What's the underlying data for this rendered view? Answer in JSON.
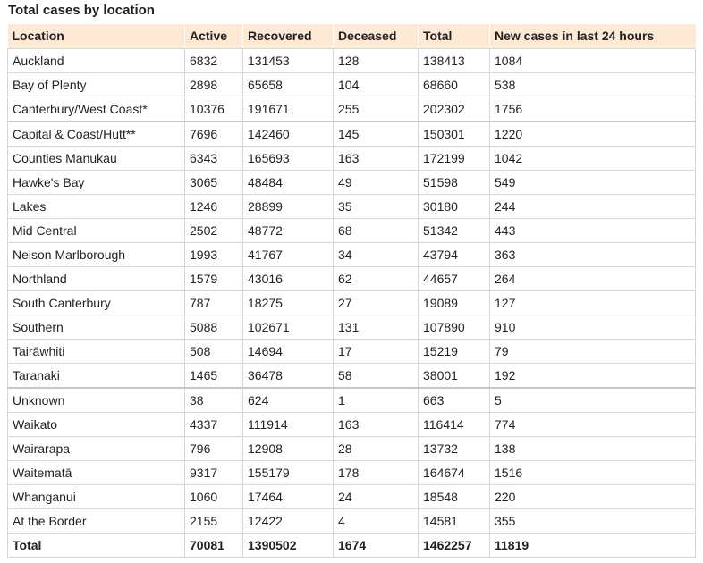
{
  "caption": "Total cases by location",
  "columns": [
    "Location",
    "Active",
    "Recovered",
    "Deceased",
    "Total",
    "New cases in last 24 hours"
  ],
  "rows": [
    [
      "Auckland",
      "6832",
      "131453",
      "128",
      "138413",
      "1084"
    ],
    [
      "Bay of Plenty",
      "2898",
      "65658",
      "104",
      "68660",
      "538"
    ],
    [
      "Canterbury/West Coast*",
      "10376",
      "191671",
      "255",
      "202302",
      "1756"
    ],
    [
      "Capital & Coast/Hutt**",
      "7696",
      "142460",
      "145",
      "150301",
      "1220"
    ],
    [
      "Counties Manukau",
      "6343",
      "165693",
      "163",
      "172199",
      "1042"
    ],
    [
      "Hawke's Bay",
      "3065",
      "48484",
      "49",
      "51598",
      "549"
    ],
    [
      "Lakes",
      "1246",
      "28899",
      "35",
      "30180",
      "244"
    ],
    [
      "Mid Central",
      "2502",
      "48772",
      "68",
      "51342",
      "443"
    ],
    [
      "Nelson Marlborough",
      "1993",
      "41767",
      "34",
      "43794",
      "363"
    ],
    [
      "Northland",
      "1579",
      "43016",
      "62",
      "44657",
      "264"
    ],
    [
      "South Canterbury",
      "787",
      "18275",
      "27",
      "19089",
      "127"
    ],
    [
      "Southern",
      "5088",
      "102671",
      "131",
      "107890",
      "910"
    ],
    [
      "Tairāwhiti",
      "508",
      "14694",
      "17",
      "15219",
      "79"
    ],
    [
      "Taranaki",
      "1465",
      "36478",
      "58",
      "38001",
      "192"
    ],
    [
      "Unknown",
      "38",
      "624",
      "1",
      "663",
      "5"
    ],
    [
      "Waikato",
      "4337",
      "111914",
      "163",
      "116414",
      "774"
    ],
    [
      "Wairarapa",
      "796",
      "12908",
      "28",
      "13732",
      "138"
    ],
    [
      "Waitematā",
      "9317",
      "155179",
      "178",
      "164674",
      "1516"
    ],
    [
      "Whanganui",
      "1060",
      "17464",
      "24",
      "18548",
      "220"
    ],
    [
      "At the Border",
      "2155",
      "12422",
      "4",
      "14581",
      "355"
    ]
  ],
  "total": [
    "Total",
    "70081",
    "1390502",
    "1674",
    "1462257",
    "11819"
  ]
}
